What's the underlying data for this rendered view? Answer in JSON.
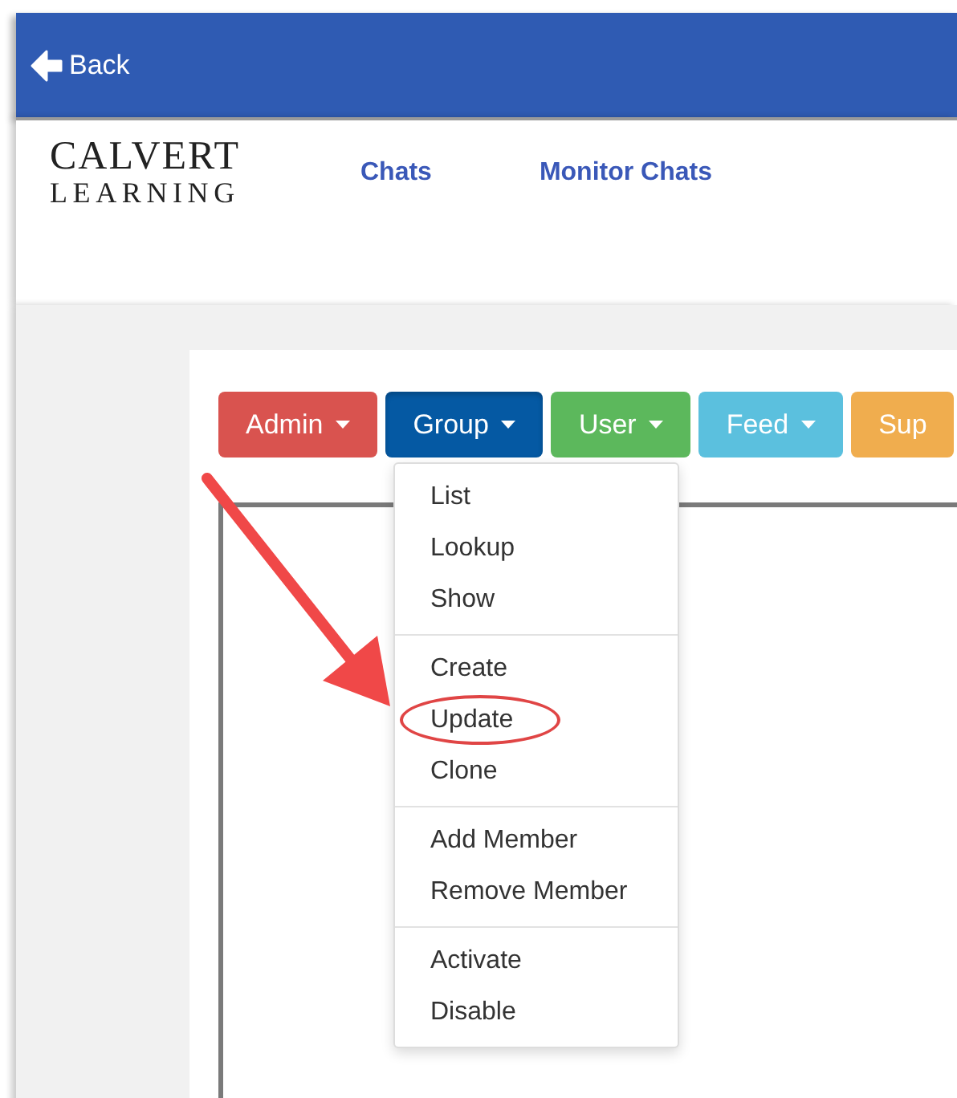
{
  "top_bar": {
    "back_label": "Back"
  },
  "header": {
    "logo_lines": [
      "CALVERT",
      "LEARNING"
    ],
    "nav_links": [
      "Chats",
      "Monitor Chats"
    ]
  },
  "menu_buttons": [
    {
      "label": "Admin",
      "color": "#d9534f",
      "caret": true,
      "open": false
    },
    {
      "label": "Group",
      "color": "#0559a3",
      "caret": true,
      "open": true
    },
    {
      "label": "User",
      "color": "#5cb85c",
      "caret": true,
      "open": false
    },
    {
      "label": "Feed",
      "color": "#5bc0de",
      "caret": true,
      "open": false
    },
    {
      "label": "Sup",
      "color": "#f0ad4e",
      "caret": false,
      "open": false
    }
  ],
  "dropdown": {
    "groups": [
      {
        "items": [
          {
            "label": "List",
            "circled": false
          },
          {
            "label": "Lookup",
            "circled": false
          },
          {
            "label": "Show",
            "circled": false
          }
        ]
      },
      {
        "items": [
          {
            "label": "Create",
            "circled": false
          },
          {
            "label": "Update",
            "circled": true
          },
          {
            "label": "Clone",
            "circled": false
          }
        ]
      },
      {
        "items": [
          {
            "label": "Add Member",
            "circled": false
          },
          {
            "label": "Remove Member",
            "circled": false
          }
        ]
      },
      {
        "items": [
          {
            "label": "Activate",
            "circled": false
          },
          {
            "label": "Disable",
            "circled": false
          }
        ]
      }
    ]
  }
}
